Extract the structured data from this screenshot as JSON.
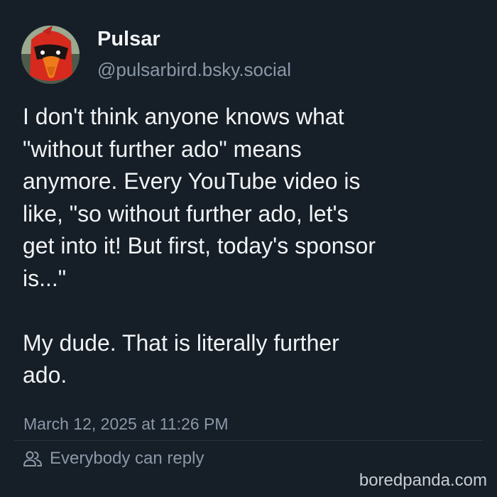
{
  "author": {
    "display_name": "Pulsar",
    "handle": "@pulsarbird.bsky.social",
    "avatar_icon": "red-cardinal-avatar"
  },
  "post": {
    "lines_para1": [
      "I don't think anyone knows what",
      "\"without further ado\" means",
      "anymore. Every YouTube video is",
      "like, \"so without further ado, let's",
      "get into it! But first, today's sponsor",
      "is...\""
    ],
    "lines_para2": [
      "My dude. That is literally further",
      "ado."
    ]
  },
  "timestamp": "March 12, 2025 at 11:26 PM",
  "reply_setting": {
    "icon": "people-icon",
    "label": "Everybody can reply"
  },
  "watermark": "boredpanda.com",
  "colors": {
    "background": "#161e27",
    "text": "#f1f3f5",
    "muted": "#8a98a8"
  }
}
